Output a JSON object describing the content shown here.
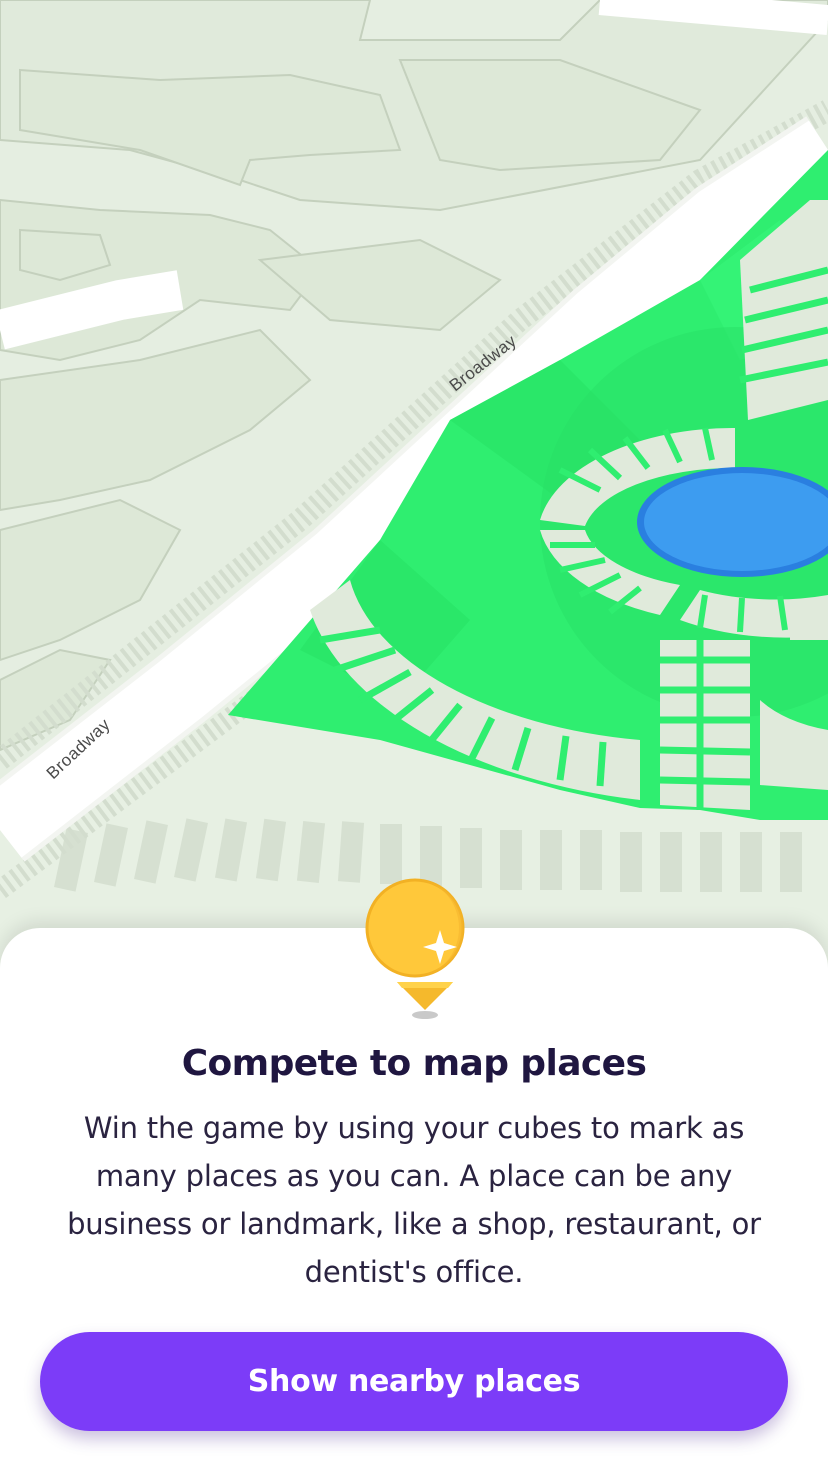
{
  "map": {
    "road_labels": [
      "Broadway",
      "Broadway"
    ]
  },
  "onboarding": {
    "icon": "coin-pin-icon",
    "title": "Compete to map places",
    "body": "Win the game by using your cubes to mark as many places as you can. A place can be any business or landmark, like a shop, restaurant, or dentist's office.",
    "cta_label": "Show nearby places"
  },
  "colors": {
    "map_base": "#e4ede0",
    "park_green": "#2fee70",
    "pond_blue": "#3d9cf0",
    "road": "#ffffff",
    "sheet": "#ffffff",
    "title_text": "#1f1640",
    "cta_background": "#7c3cf8",
    "coin_gold": "#ffc83a"
  }
}
